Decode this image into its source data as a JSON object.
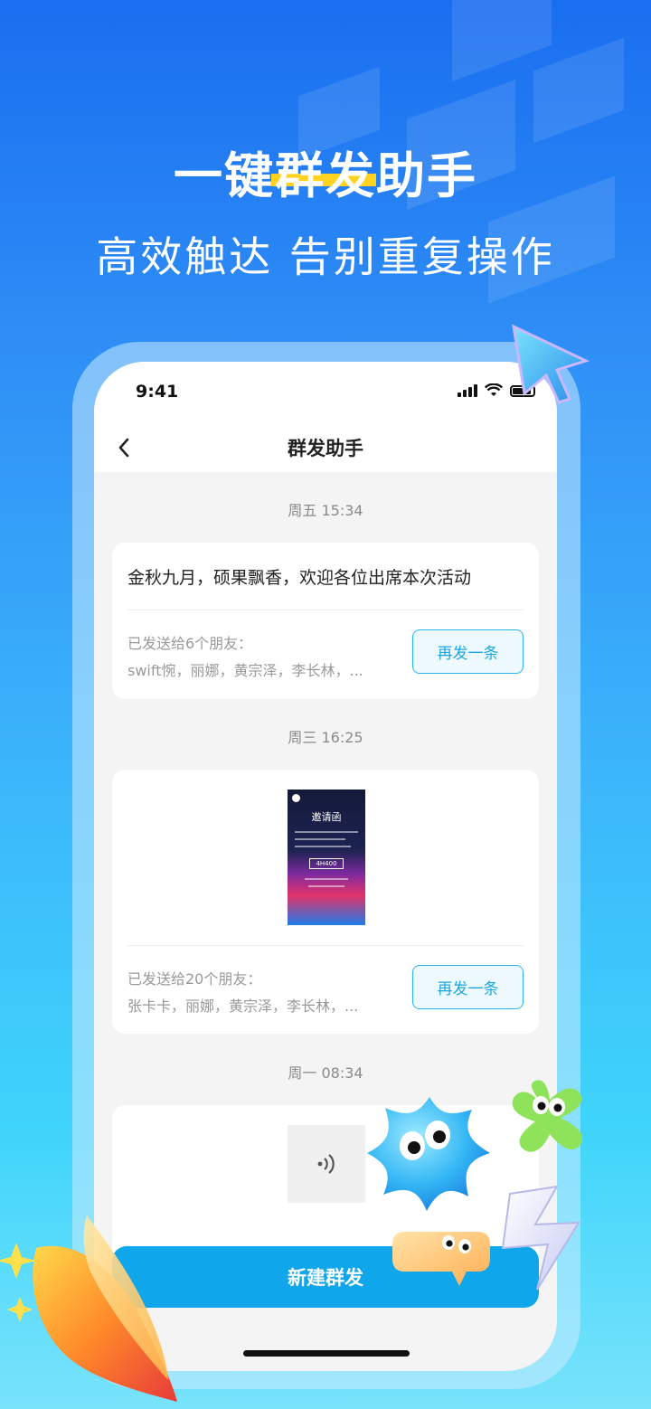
{
  "promo": {
    "headline": "一键群发助手",
    "subline": "高效触达 告别重复操作"
  },
  "status_bar": {
    "time": "9:41"
  },
  "nav": {
    "title": "群发助手"
  },
  "messages": [
    {
      "timestamp": "周五 15:34",
      "text": "金秋九月，硕果飘香，欢迎各位出席本次活动",
      "sent_label": "已发送给6个朋友：",
      "recipients": "swift惋，丽娜，黄宗泽，李长林，...",
      "resend_label": "再发一条"
    },
    {
      "timestamp": "周三 16:25",
      "poster": {
        "title": "邀请函",
        "code": "4H400"
      },
      "sent_label": "已发送给20个朋友：",
      "recipients": "张卡卡，丽娜，黄宗泽，李长林，...",
      "resend_label": "再发一条"
    },
    {
      "timestamp": "周一 08:34",
      "type": "voice"
    }
  ],
  "new_button_label": "新建群发",
  "colors": {
    "accent": "#10a6ec",
    "highlight": "#ffd21f"
  }
}
